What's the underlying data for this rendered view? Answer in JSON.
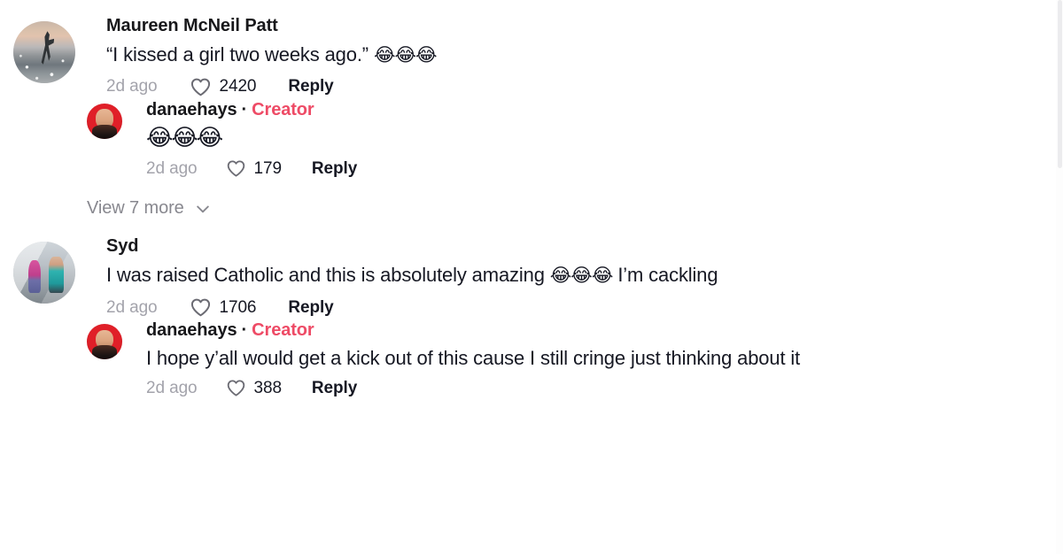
{
  "colors": {
    "creator_badge": "#ee4b66",
    "text_primary": "#161823",
    "text_muted": "#a3a3ab",
    "view_more": "#88888f",
    "heart_outline": "#6b6b73",
    "background": "#ffffff"
  },
  "icons": {
    "heart": "heart-outline-icon",
    "chevron": "chevron-down-icon"
  },
  "comments": [
    {
      "author": "Maureen McNeil Patt",
      "avatar": "dancer-on-beach-photo",
      "text": "“I kissed a girl two weeks ago.” ",
      "emoji": "😂😂😂",
      "timestamp": "2d ago",
      "likes": "2420",
      "reply_label": "Reply",
      "is_creator": false,
      "replies": [
        {
          "author": "danaehays",
          "avatar": "creator-portrait-red-photo",
          "badge": "Creator",
          "separator": "·",
          "text": "",
          "emoji": "😂😂😂",
          "timestamp": "2d ago",
          "likes": "179",
          "reply_label": "Reply",
          "is_creator": true
        }
      ],
      "view_more_label": "View 7 more"
    },
    {
      "author": "Syd",
      "avatar": "gym-friends-photo",
      "text_before": "I was raised Catholic and this is absolutely amazing ",
      "emoji": "😂😂😂",
      "text_after": " I’m cackling",
      "timestamp": "2d ago",
      "likes": "1706",
      "reply_label": "Reply",
      "is_creator": false,
      "replies": [
        {
          "author": "danaehays",
          "avatar": "creator-portrait-red-photo",
          "badge": "Creator",
          "separator": "·",
          "text": "I hope y’all would get a kick out of this cause I still cringe just thinking about it",
          "timestamp": "2d ago",
          "likes": "388",
          "reply_label": "Reply",
          "is_creator": true
        }
      ]
    }
  ]
}
